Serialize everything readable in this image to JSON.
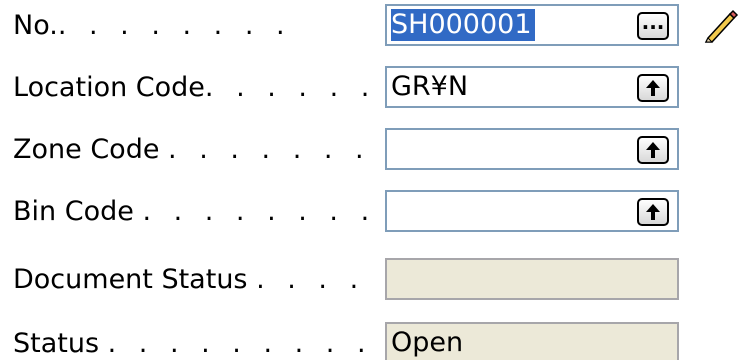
{
  "fields": [
    {
      "label": "No.",
      "dots": ". . . . . . . .",
      "value": "SH000001",
      "value_selected": true,
      "button_icon": "ellipsis-icon",
      "extra_icon": "pencil-icon",
      "readonly": false
    },
    {
      "label": "Location Code",
      "dots": ". . . . . .",
      "value": "GR¥N",
      "button_icon": "lookup-arrow-icon",
      "readonly": false
    },
    {
      "label": "Zone Code",
      "dots": ". . . . . . .",
      "value": "",
      "button_icon": "lookup-arrow-icon",
      "readonly": false
    },
    {
      "label": "Bin Code",
      "dots": ". . . . . . . .",
      "value": "",
      "button_icon": "lookup-arrow-icon",
      "readonly": false
    },
    {
      "label": "Document Status",
      "dots": ". . . . .",
      "value": "",
      "readonly": true
    },
    {
      "label": "Status",
      "dots": ". . . . . . . . .",
      "value": "Open",
      "readonly": true
    }
  ],
  "colors": {
    "selection": "#316ac5",
    "field_border": "#7f9db9",
    "readonly_background": "#ece9d8"
  }
}
